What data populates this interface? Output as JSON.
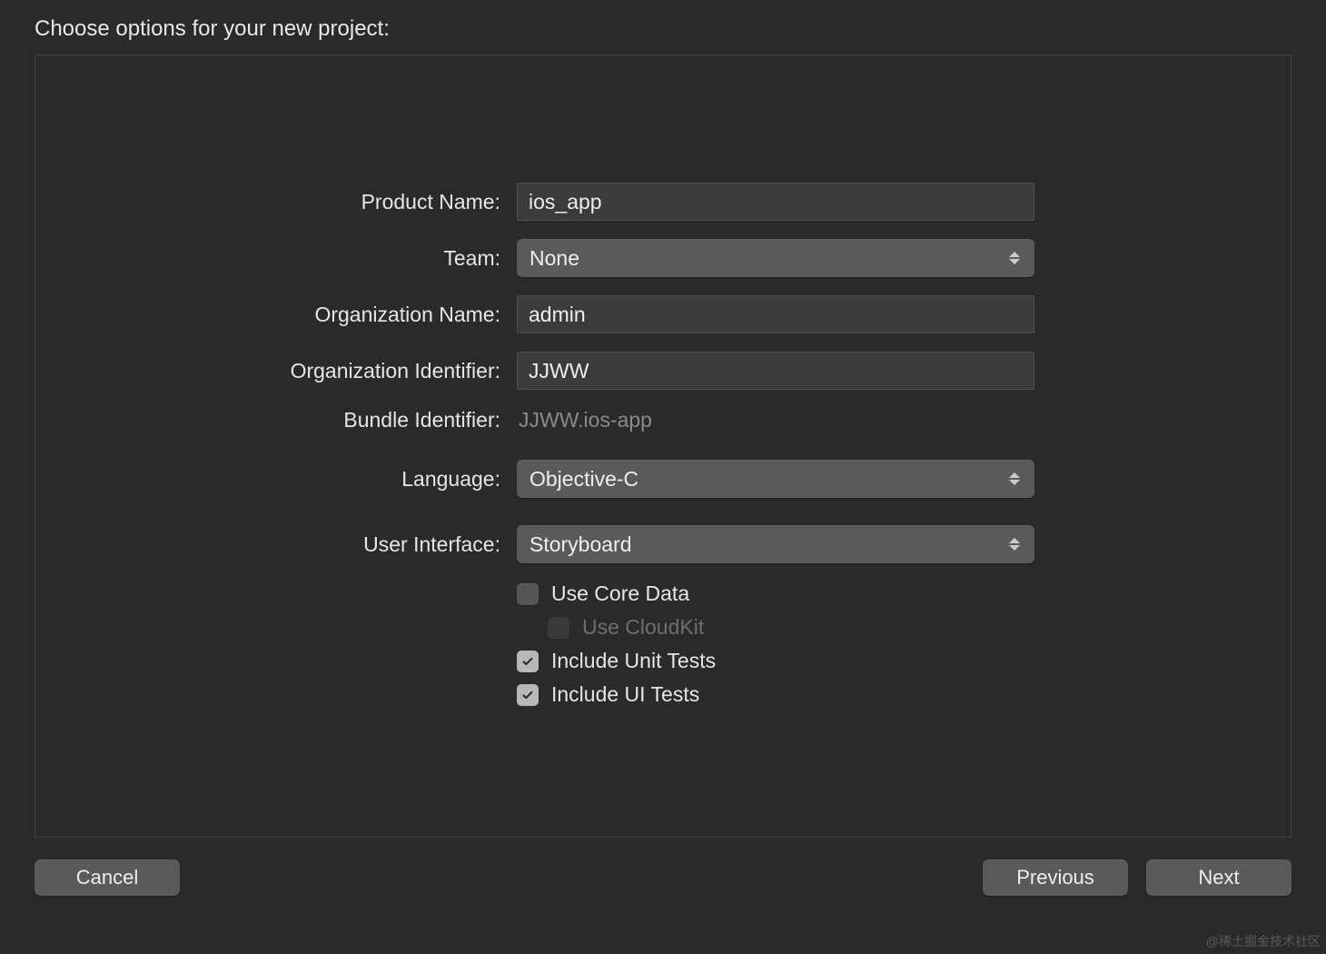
{
  "heading": "Choose options for your new project:",
  "fields": {
    "product_name": {
      "label": "Product Name:",
      "value": "ios_app"
    },
    "team": {
      "label": "Team:",
      "value": "None"
    },
    "org_name": {
      "label": "Organization Name:",
      "value": "admin"
    },
    "org_identifier": {
      "label": "Organization Identifier:",
      "value": "JJWW"
    },
    "bundle_identifier": {
      "label": "Bundle Identifier:",
      "value": "JJWW.ios-app"
    },
    "language": {
      "label": "Language:",
      "value": "Objective-C"
    },
    "user_interface": {
      "label": "User Interface:",
      "value": "Storyboard"
    }
  },
  "checkboxes": {
    "use_core_data": {
      "label": "Use Core Data",
      "checked": false
    },
    "use_cloudkit": {
      "label": "Use CloudKit",
      "checked": false,
      "disabled": true
    },
    "include_unit_tests": {
      "label": "Include Unit Tests",
      "checked": true
    },
    "include_ui_tests": {
      "label": "Include UI Tests",
      "checked": true
    }
  },
  "buttons": {
    "cancel": "Cancel",
    "previous": "Previous",
    "next": "Next"
  },
  "watermark": "@稀土掘金技术社区"
}
